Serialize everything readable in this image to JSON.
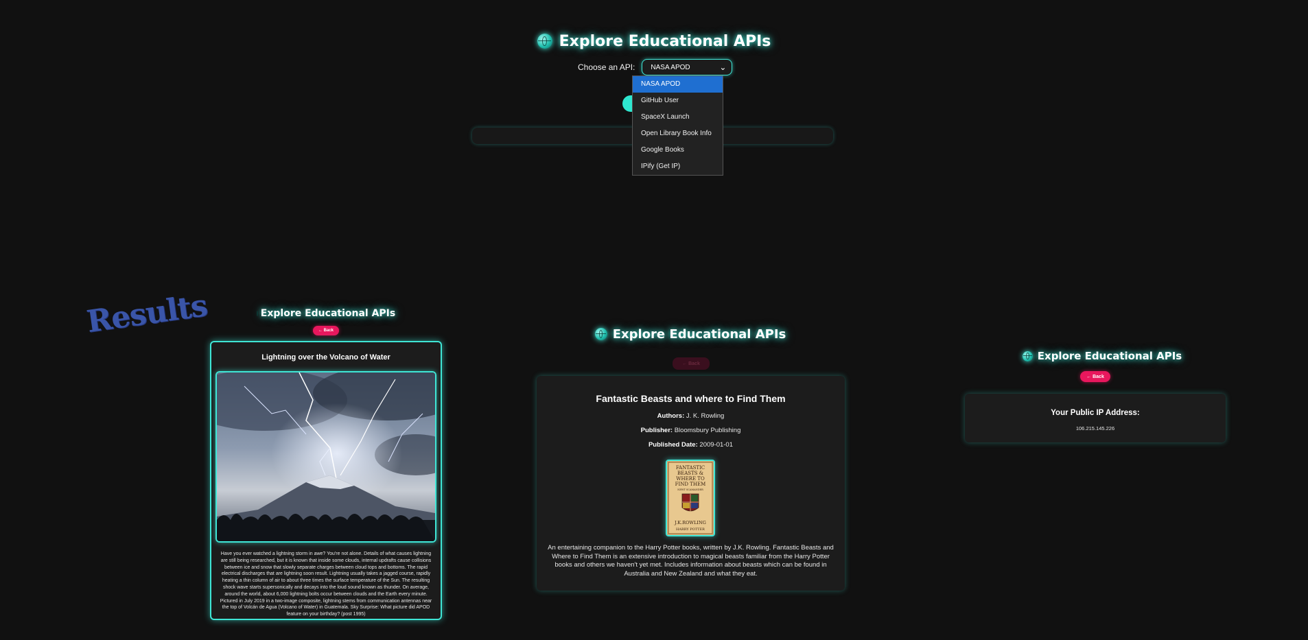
{
  "app": {
    "title": "Explore Educational APIs",
    "choose_label": "Choose an API:",
    "selected_api": "NASA APOD",
    "api_options": [
      "NASA APOD",
      "GitHub User",
      "SpaceX Launch",
      "Open Library Book Info",
      "Google Books",
      "IPify (Get IP)"
    ]
  },
  "results_label": "Results",
  "panels": {
    "nasa": {
      "header_title": "Explore Educational APIs",
      "back_label": "← Back",
      "title": "Lightning over the Volcano of Water",
      "explanation": "Have you ever watched a lightning storm in awe? You're not alone. Details of what causes lightning are still being researched, but it is known that inside some clouds, internal updrafts cause collisions between ice and snow that slowly separate charges between cloud tops and bottoms. The rapid electrical discharges that are lightning soon result. Lightning usually takes a jagged course, rapidly heating a thin column of air to about three times the surface temperature of the Sun. The resulting shock wave starts supersonically and decays into the loud sound known as thunder. On average, around the world, about 6,000 lightning bolts occur between clouds and the Earth every minute. Pictured in July 2019 in a two-image composite, lightning stems from communication antennas near the top of Volcán de Agua (Volcano of Water) in Guatemala. Sky Surprise: What picture did APOD feature on your birthday? (post 1995)"
    },
    "books": {
      "header_title": "Explore Educational APIs",
      "back_label": "← Back",
      "title": "Fantastic Beasts and where to Find Them",
      "authors_label": "Authors:",
      "authors": "J. K. Rowling",
      "publisher_label": "Publisher:",
      "publisher": "Bloomsbury Publishing",
      "published_label": "Published Date:",
      "published_date": "2009-01-01",
      "cover_lines": [
        "FANTASTIC",
        "BEASTS &",
        "WHERE TO",
        "FIND THEM",
        "NEWT SCAMANDER",
        "J.K.ROWLING",
        "HARRY POTTER"
      ],
      "description": "An entertaining companion to the Harry Potter books, written by J.K. Rowling. Fantastic Beasts and Where to Find Them is an extensive introduction to magical beasts familiar from the Harry Potter books and others we haven't yet met. Includes information about beasts which can be found in Australia and New Zealand and what they eat."
    },
    "ip": {
      "header_title": "Explore Educational APIs",
      "back_label": "← Back",
      "title": "Your Public IP Address:",
      "ip_address": "106.215.145.226"
    }
  },
  "colors": {
    "accent": "#3fe6d6",
    "back_button": "#e8175d",
    "dropdown_selected": "#1f6fd1",
    "results_text": "#3a55a8"
  }
}
